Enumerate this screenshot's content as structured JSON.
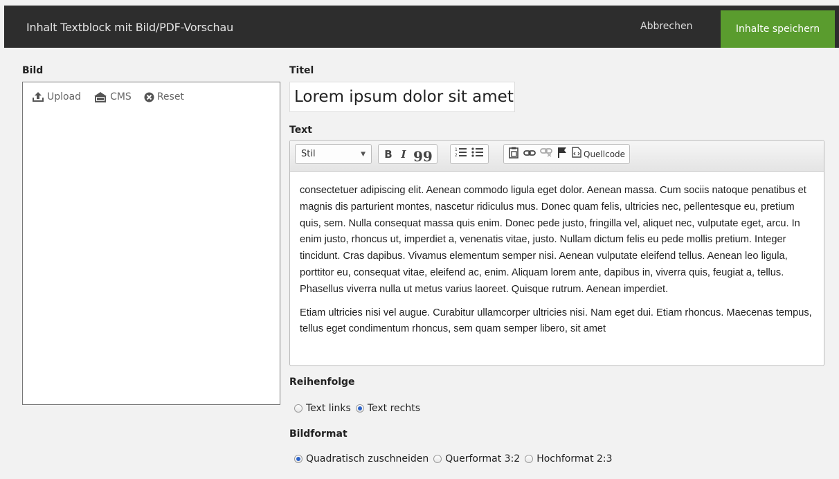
{
  "header": {
    "title": "Inhalt Textblock mit Bild/PDF-Vorschau",
    "cancel_label": "Abbrechen",
    "save_label": "Inhalte speichern"
  },
  "image": {
    "label": "Bild",
    "actions": [
      {
        "label": "Upload",
        "icon": "upload-icon"
      },
      {
        "label": "CMS",
        "icon": "cms-icon"
      },
      {
        "label": "Reset",
        "icon": "reset-icon"
      }
    ]
  },
  "title_field": {
    "label": "Titel",
    "value": "Lorem ipsum dolor sit amet"
  },
  "text_field": {
    "label": "Text",
    "toolbar": {
      "style_select": "Stil",
      "bold": "B",
      "italic": "I",
      "quote": "99",
      "source_label": "Quellcode",
      "icons": [
        "bold-icon",
        "italic-icon",
        "blockquote-icon",
        "numbered-list-icon",
        "bulleted-list-icon",
        "paste-icon",
        "link-icon",
        "unlink-icon",
        "anchor-flag-icon",
        "source-code-icon"
      ]
    },
    "paragraphs": [
      "consectetuer adipiscing elit. Aenean commodo ligula eget dolor. Aenean massa. Cum sociis natoque penatibus et magnis dis parturient montes, nascetur ridiculus mus. Donec quam felis, ultricies nec, pellentesque eu, pretium quis, sem. Nulla consequat massa quis enim. Donec pede justo, fringilla vel, aliquet nec, vulputate eget, arcu. In enim justo, rhoncus ut, imperdiet a, venenatis vitae, justo. Nullam dictum felis eu pede mollis pretium. Integer tincidunt. Cras dapibus. Vivamus elementum semper nisi. Aenean vulputate eleifend tellus. Aenean leo ligula, porttitor eu, consequat vitae, eleifend ac, enim. Aliquam lorem ante, dapibus in, viverra quis, feugiat a, tellus. Phasellus viverra nulla ut metus varius laoreet. Quisque rutrum. Aenean imperdiet.",
      "Etiam ultricies nisi vel augue. Curabitur ullamcorper ultricies nisi. Nam eget dui. Etiam rhoncus. Maecenas tempus, tellus eget condimentum rhoncus, sem quam semper libero, sit amet"
    ]
  },
  "order": {
    "label": "Reihenfolge",
    "options": [
      {
        "label": "Text links",
        "checked": false
      },
      {
        "label": "Text rechts",
        "checked": true
      }
    ]
  },
  "format": {
    "label": "Bildformat",
    "options": [
      {
        "label": "Quadratisch zuschneiden",
        "checked": true
      },
      {
        "label": "Querformat 3:2",
        "checked": false
      },
      {
        "label": "Hochformat 2:3",
        "checked": false
      }
    ]
  },
  "colors": {
    "header_bg": "#2d2d2d",
    "save_button": "#5a9c2e",
    "radio_checked": "#2b62c8"
  }
}
